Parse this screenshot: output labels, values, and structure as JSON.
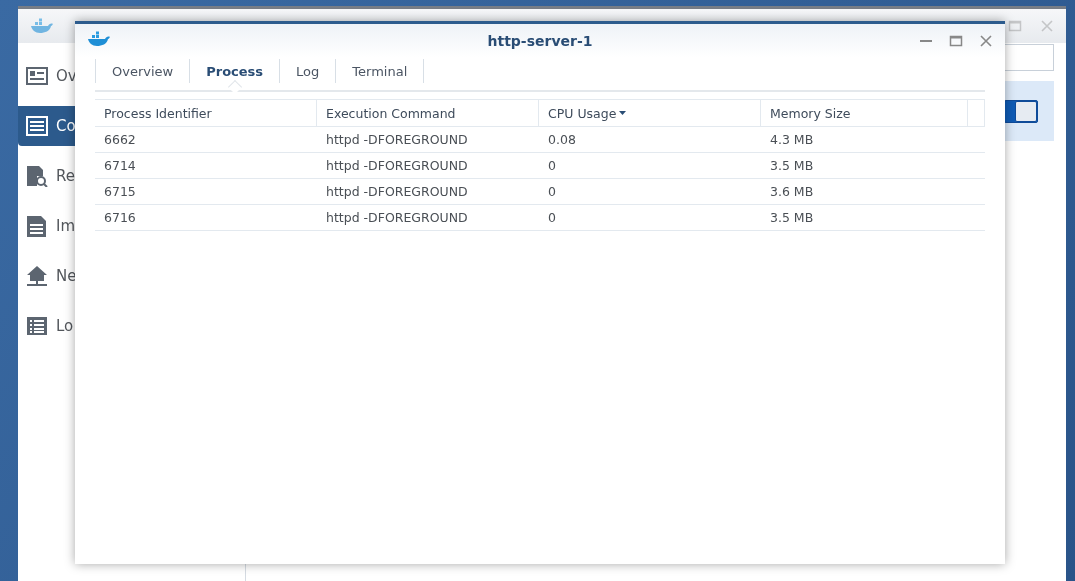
{
  "background_window": {
    "sidebar": {
      "items": [
        {
          "label": "Ov",
          "kind": "card",
          "selected": false
        },
        {
          "label": "Co",
          "kind": "list",
          "selected": true
        },
        {
          "label": "Re",
          "kind": "search-doc",
          "selected": false
        },
        {
          "label": "Im",
          "kind": "doc",
          "selected": false
        },
        {
          "label": "Ne",
          "kind": "network",
          "selected": false
        },
        {
          "label": "Lo",
          "kind": "log",
          "selected": false
        }
      ]
    },
    "toggle": {
      "on": true
    }
  },
  "window": {
    "title": "http-server-1",
    "tabs": [
      {
        "label": "Overview",
        "selected": false
      },
      {
        "label": "Process",
        "selected": true
      },
      {
        "label": "Log",
        "selected": false
      },
      {
        "label": "Terminal",
        "selected": false
      }
    ],
    "table": {
      "columns": [
        {
          "label": "Process Identifier",
          "sorted": false
        },
        {
          "label": "Execution Command",
          "sorted": false
        },
        {
          "label": "CPU Usage",
          "sorted": true
        },
        {
          "label": "Memory Size",
          "sorted": false
        }
      ],
      "rows": [
        [
          "6662",
          "httpd -DFOREGROUND",
          "0.08",
          "4.3 MB"
        ],
        [
          "6714",
          "httpd -DFOREGROUND",
          "0",
          "3.5 MB"
        ],
        [
          "6715",
          "httpd -DFOREGROUND",
          "0",
          "3.6 MB"
        ],
        [
          "6716",
          "httpd -DFOREGROUND",
          "0",
          "3.5 MB"
        ]
      ]
    }
  }
}
